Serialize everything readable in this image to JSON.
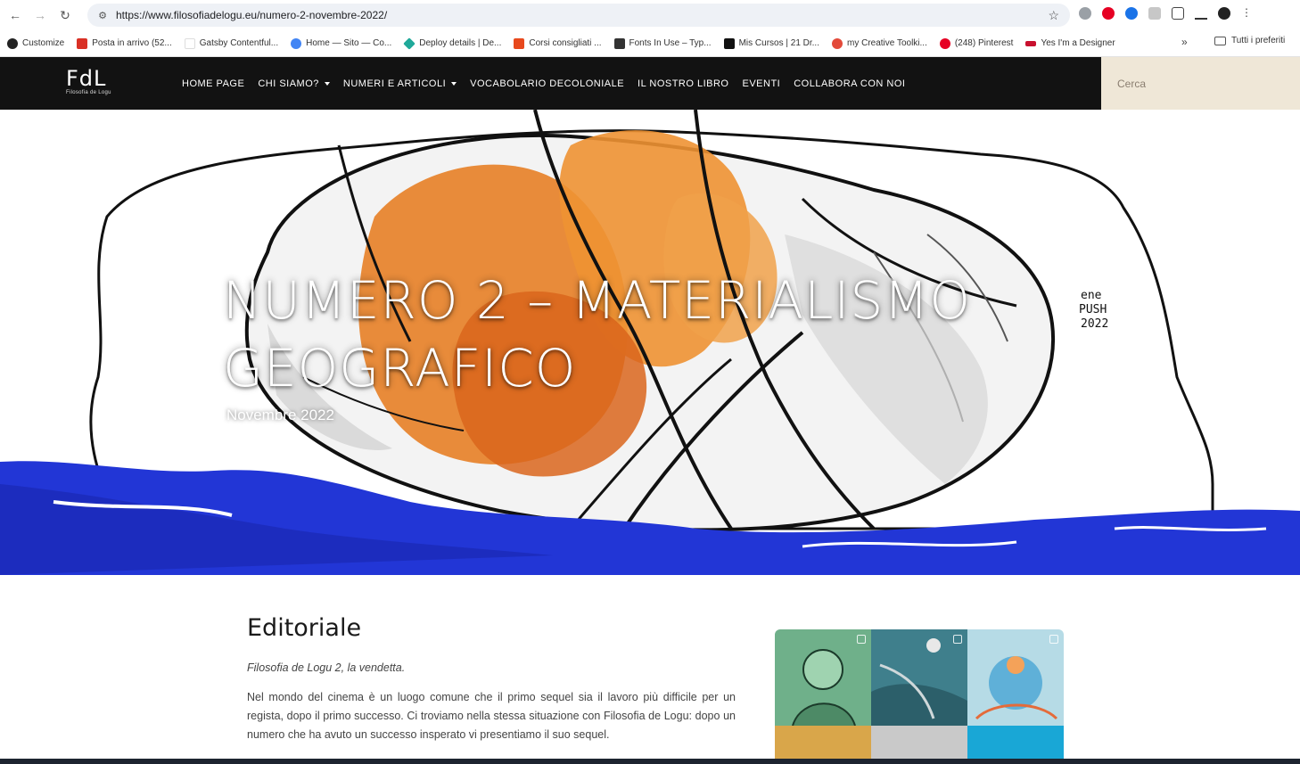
{
  "browser": {
    "url": "https://www.filosofiadelogu.eu/numero-2-novembre-2022/",
    "bookmarks": [
      {
        "label": "Customize",
        "color": "#222222"
      },
      {
        "label": "Posta in arrivo (52...",
        "color": "#d93025"
      },
      {
        "label": "Gatsby Contentful...",
        "color": "#ffffff"
      },
      {
        "label": "Home — Sito — Co...",
        "color": "#4285f4"
      },
      {
        "label": "Deploy details | De...",
        "color": "#20a99a"
      },
      {
        "label": "Corsi consigliati ...",
        "color": "#e8491d"
      },
      {
        "label": "Fonts In Use – Typ...",
        "color": "#333333"
      },
      {
        "label": "Mis Cursos | 21 Dr...",
        "color": "#111111"
      },
      {
        "label": "my Creative Toolki...",
        "color": "#e34a3a"
      },
      {
        "label": "(248) Pinterest",
        "color": "#e60023"
      },
      {
        "label": "Yes I'm a Designer",
        "color": "#c8102e"
      }
    ],
    "bookmarks_more": "»",
    "all_bookmarks": "Tutti i preferiti"
  },
  "site": {
    "logo": "FdL",
    "logo_sub": "Filosofia de Logu",
    "nav": [
      {
        "label": "HOME PAGE",
        "dropdown": false
      },
      {
        "label": "CHI SIAMO?",
        "dropdown": true
      },
      {
        "label": "NUMERI E ARTICOLI",
        "dropdown": true
      },
      {
        "label": "VOCABOLARIO DECOLONIALE",
        "dropdown": false
      },
      {
        "label": "IL NOSTRO LIBRO",
        "dropdown": false
      },
      {
        "label": "EVENTI",
        "dropdown": false
      },
      {
        "label": "COLLABORA CON NOI",
        "dropdown": false
      }
    ],
    "search_placeholder": "Cerca"
  },
  "hero": {
    "title_line1": "NUMERO 2 – MATERIALISMO",
    "title_line2": "GEOGRAFICO",
    "date": "Novembre 2022",
    "signature_line1": "ene",
    "signature_line2": "PUSH",
    "signature_line3": "2022"
  },
  "article": {
    "heading": "Editoriale",
    "lead": "Filosofia de Logu 2, la vendetta.",
    "body": "Nel mondo del cinema è un luogo comune che il primo sequel sia il lavoro più difficile per un regista, dopo il primo successo. Ci troviamo nella stessa situazione con Filosofia de Logu: dopo un numero che ha avuto un successo insperato vi presentiamo il suo sequel."
  },
  "colors": {
    "header_bg": "#121212",
    "search_bg": "#efe7d7",
    "orange": "#e7822a",
    "sea_blue": "#2236d6"
  }
}
